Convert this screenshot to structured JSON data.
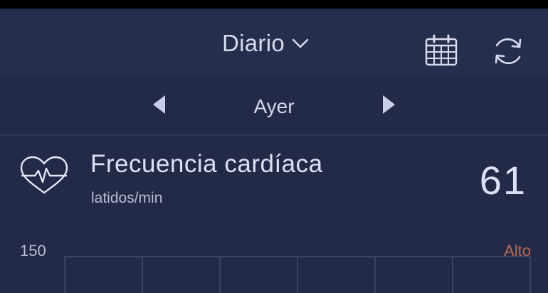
{
  "header": {
    "view_label": "Diario",
    "dropdown_icon": "chevron-down-icon",
    "calendar_icon": "calendar-icon",
    "sync_icon": "sync-icon"
  },
  "date_nav": {
    "prev_icon": "triangle-left-icon",
    "label": "Ayer",
    "next_icon": "triangle-right-icon"
  },
  "metric": {
    "icon": "heart-rate-icon",
    "title": "Frecuencia cardíaca",
    "unit": "latidos/min",
    "value": "61"
  },
  "chart": {
    "y_max_label": "150",
    "zone_label": "Alto"
  },
  "colors": {
    "background": "#232a47",
    "top_bar": "#262e4d",
    "text": "#dde0f4",
    "zone_high": "#b86a58"
  }
}
